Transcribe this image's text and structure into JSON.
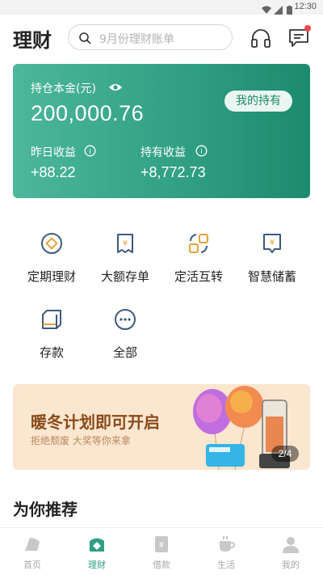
{
  "status_bar": {
    "time": "12:30"
  },
  "header": {
    "title": "理财",
    "search_placeholder": "9月份理财账单",
    "icons": [
      "search-icon",
      "headset-icon",
      "message-icon"
    ]
  },
  "asset_card": {
    "principal_label": "持仓本金(元)",
    "principal_value": "200,000.76",
    "holding_button": "我的持有",
    "yesterday_label": "昨日收益",
    "yesterday_value": "+88.22",
    "holding_income_label": "持有收益",
    "holding_income_value": "+8,772.73",
    "colors": {
      "start": "#4db79a",
      "end": "#1c8a6d"
    }
  },
  "products": [
    {
      "label": "定期理财",
      "icon": "fixed-term-icon"
    },
    {
      "label": "大额存单",
      "icon": "certificate-deposit-icon"
    },
    {
      "label": "定活互转",
      "icon": "transfer-icon"
    },
    {
      "label": "智慧储蓄",
      "icon": "smart-savings-icon"
    },
    {
      "label": "存款",
      "icon": "deposit-icon"
    },
    {
      "label": "全部",
      "icon": "more-icon"
    }
  ],
  "banner": {
    "title": "暖冬计划即可开启",
    "subtitle": "拒绝颓废  大奖等你来拿",
    "page_indicator": "2/4"
  },
  "recommend": {
    "title": "为你推荐"
  },
  "tabbar": [
    {
      "label": "首页",
      "icon": "home-icon",
      "active": false
    },
    {
      "label": "理财",
      "icon": "wealth-icon",
      "active": true
    },
    {
      "label": "借款",
      "icon": "loan-icon",
      "active": false
    },
    {
      "label": "生活",
      "icon": "life-icon",
      "active": false
    },
    {
      "label": "我的",
      "icon": "profile-icon",
      "active": false
    }
  ],
  "theme": {
    "accent": "#2f9e82",
    "icon_blue": "#3d5a80",
    "tab_inactive": "#a8a8a8"
  }
}
